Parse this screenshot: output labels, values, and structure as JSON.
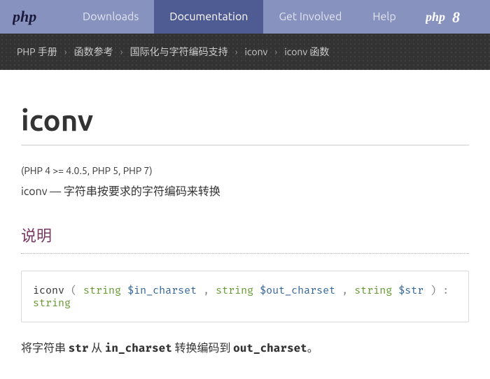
{
  "nav": {
    "items": [
      "Downloads",
      "Documentation",
      "Get Involved",
      "Help"
    ],
    "active_index": 1
  },
  "breadcrumb": [
    "PHP 手册",
    "函数参考",
    "国际化与字符编码支持",
    "iconv",
    "iconv 函数"
  ],
  "page": {
    "title": "iconv",
    "version_info": "(PHP 4 >= 4.0.5, PHP 5, PHP 7)",
    "summary": "iconv — 字符串按要求的字符编码来转换",
    "section_description_label": "说明",
    "desc_part1": "将字符串 ",
    "desc_str": "str",
    "desc_part2": " 从 ",
    "desc_in": "in_charset",
    "desc_part3": " 转换编码到 ",
    "desc_out": "out_charset",
    "desc_part4": "。"
  },
  "synopsis": {
    "name": "iconv",
    "params": [
      {
        "type": "string",
        "name": "$in_charset"
      },
      {
        "type": "string",
        "name": "$out_charset"
      },
      {
        "type": "string",
        "name": "$str"
      }
    ],
    "return_type": "string"
  }
}
